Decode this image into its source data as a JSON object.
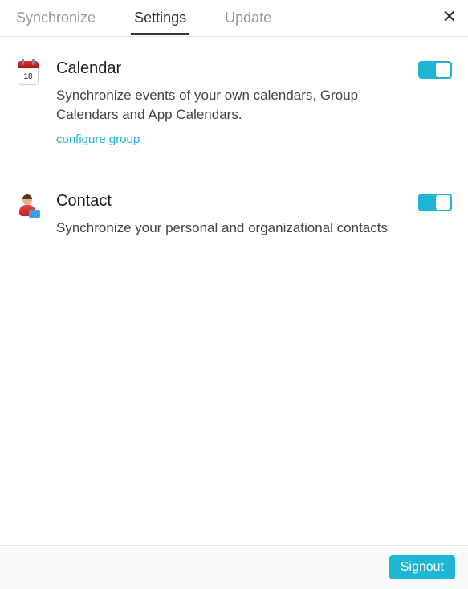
{
  "tabs": [
    {
      "label": "Synchronize",
      "active": false
    },
    {
      "label": "Settings",
      "active": true
    },
    {
      "label": "Update",
      "active": false
    }
  ],
  "close": "✕",
  "sections": {
    "calendar": {
      "title": "Calendar",
      "desc": "Synchronize events of your own calendars, Group Calendars and App Calendars.",
      "link": "configure group",
      "icon_day": "18",
      "toggle_on": true
    },
    "contact": {
      "title": "Contact",
      "desc": "Synchronize your personal and organizational contacts",
      "toggle_on": true
    }
  },
  "signout_label": "Signout"
}
